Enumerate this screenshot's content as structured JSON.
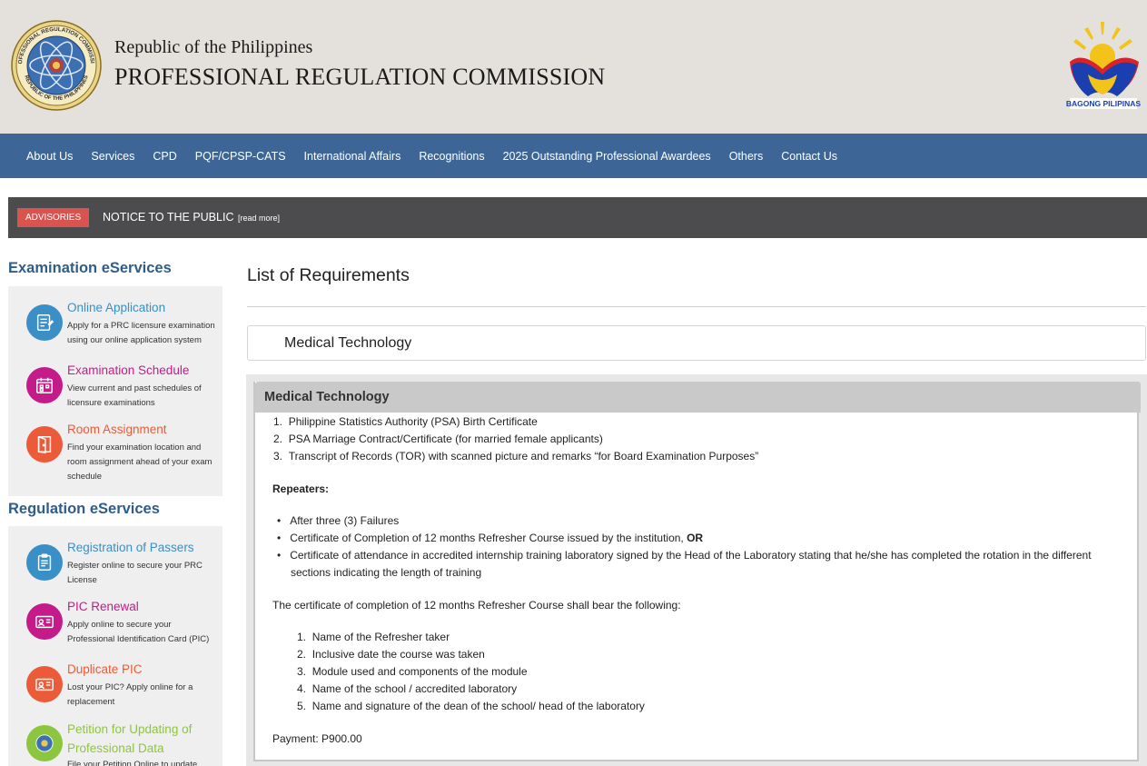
{
  "header": {
    "republic": "Republic of the Philippines",
    "agency": "PROFESSIONAL REGULATION COMMISSION",
    "seal_text_top": "PROFESSIONAL REGULATION COMMISSION",
    "seal_text_bottom": "REPUBLIC OF THE PHILIPPINES",
    "bp_text": "BAGONG PILIPINAS"
  },
  "nav": {
    "items": [
      "About Us",
      "Services",
      "CPD",
      "PQF/CPSP-CATS",
      "International Affairs",
      "Recognitions",
      "2025 Outstanding Professional Awardees",
      "Others",
      "Contact Us"
    ]
  },
  "advisory": {
    "badge": "ADVISORIES",
    "text": "NOTICE TO THE PUBLIC",
    "more": "[read more]"
  },
  "sidebar": {
    "exam_title": "Examination eServices",
    "exam_items": [
      {
        "title": "Online Application",
        "desc": "Apply for a PRC licensure examination using our online application system",
        "color": "#3a8fc7",
        "icon": "application-form-icon"
      },
      {
        "title": "Examination Schedule",
        "desc": "View current and past schedules of licensure examinations",
        "color": "#c51b8a",
        "icon": "calendar-icon"
      },
      {
        "title": "Room Assignment",
        "desc": "Find your examination location and room assignment ahead of your exam schedule",
        "color": "#ec5b39",
        "icon": "door-icon"
      }
    ],
    "reg_title": "Regulation eServices",
    "reg_items": [
      {
        "title": "Registration of Passers",
        "desc": "Register online to secure your PRC License",
        "color": "#3a8fc7",
        "icon": "clipboard-icon"
      },
      {
        "title": "PIC Renewal",
        "desc": "Apply online to secure your Professional Identification Card (PIC)",
        "color": "#c51b8a",
        "icon": "id-card-icon"
      },
      {
        "title": "Duplicate PIC",
        "desc": "Lost your PIC? Apply online for a replacement",
        "color": "#ec5b39",
        "icon": "id-card-duplicate-icon"
      },
      {
        "title": "Petition for Updating of Professional Data",
        "title_line1": "Petition for Updating of",
        "title_line2": "Professional Data",
        "desc": "File your Petition Online to update",
        "color": "#8cc63f",
        "icon": "seal-icon"
      }
    ]
  },
  "main": {
    "title": "List of Requirements",
    "selected_profession": "Medical Technology",
    "card_title": "Medical Technology",
    "requirements": [
      "Philippine Statistics Authority (PSA) Birth Certificate",
      "PSA Marriage Contract/Certificate (for married female applicants)",
      "Transcript of Records (TOR) with scanned picture and remarks “for Board Examination Purposes”"
    ],
    "repeaters_label": "Repeaters:",
    "repeaters": {
      "item1": "After three (3) Failures",
      "item2_text": "Certificate of Completion of 12 months Refresher Course issued by the institution, ",
      "item2_bold": "OR",
      "item3_line1": "Certificate of attendance in accredited internship training laboratory signed by the Head of the Laboratory stating that he/she has completed the rotation in the different",
      "item3_line2": "sections indicating the length of training"
    },
    "refresher_intro": "The certificate of completion of 12 months Refresher Course shall bear the following:",
    "refresher_items": [
      "Name of the Refresher taker",
      "Inclusive date the course was taken",
      "Module used and components of the module",
      "Name of the school / accredited laboratory",
      "Name and signature of the dean of the school/ head of the laboratory"
    ],
    "payment": "Payment: P900.00"
  }
}
